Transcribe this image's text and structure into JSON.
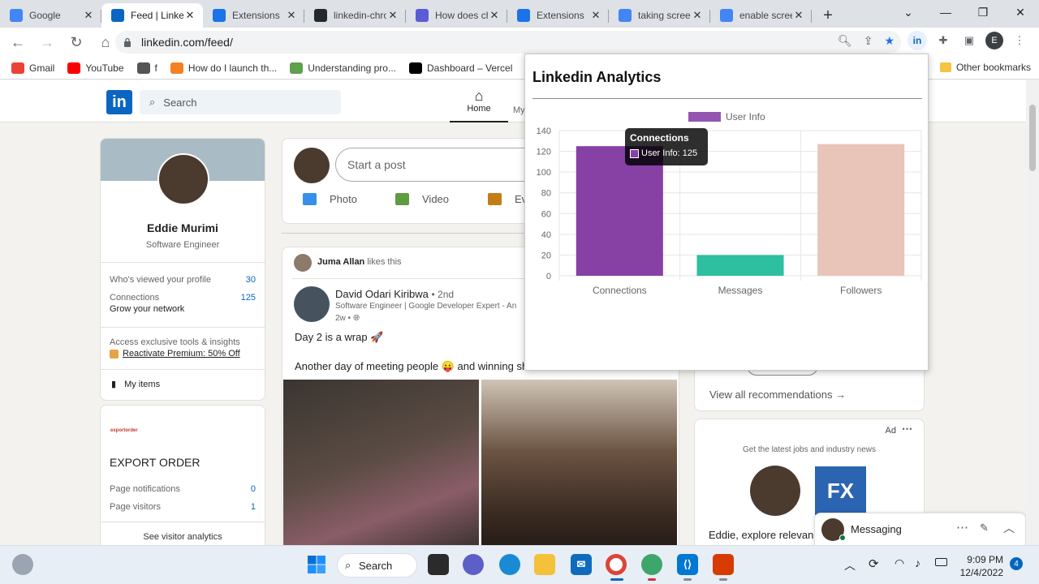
{
  "browser": {
    "tabs": [
      {
        "title": "Google",
        "icon": "google-icon",
        "color": "#4285f4"
      },
      {
        "title": "Feed | LinkedIn",
        "icon": "linkedin-icon",
        "color": "#0a66c2",
        "active": true
      },
      {
        "title": "Extensions",
        "icon": "puzzle-icon",
        "color": "#1a73e8"
      },
      {
        "title": "linkedin-chrome-ext",
        "icon": "github-icon",
        "color": "#24292f"
      },
      {
        "title": "How does chrome...",
        "icon": "page-icon",
        "color": "#5b5bd6"
      },
      {
        "title": "Extensions",
        "icon": "puzzle-icon",
        "color": "#1a73e8"
      },
      {
        "title": "taking screenshot",
        "icon": "google-icon",
        "color": "#4285f4"
      },
      {
        "title": "enable screenshot",
        "icon": "google-icon",
        "color": "#4285f4"
      }
    ],
    "url": "linkedin.com/feed/",
    "profile_initial": "E",
    "bookmarks": [
      {
        "label": "Gmail",
        "color": "#ea4335"
      },
      {
        "label": "YouTube",
        "color": "#ff0000"
      },
      {
        "label": "f",
        "color": "#555555"
      },
      {
        "label": "How do I launch th...",
        "color": "#f48024"
      },
      {
        "label": "Understanding pro...",
        "color": "#5fa04e"
      },
      {
        "label": "Dashboard – Vercel",
        "color": "#000000"
      }
    ],
    "other_bookmarks": "Other bookmarks"
  },
  "linkedin": {
    "search_placeholder": "Search",
    "nav_home": "Home",
    "nav_my": "My",
    "profile": {
      "name": "Eddie Murimi",
      "headline": "Software Engineer",
      "stats": [
        {
          "label": "Who's viewed your profile",
          "value": "30"
        },
        {
          "label": "Connections",
          "value": "125",
          "sub": "Grow your network"
        }
      ],
      "premium_text": "Access exclusive tools & insights",
      "premium_link": "Reactivate Premium: 50% Off",
      "my_items": "My items"
    },
    "page_card": {
      "logo_text": "exportorder",
      "title": "EXPORT ORDER",
      "rows": [
        {
          "label": "Page notifications",
          "value": "0"
        },
        {
          "label": "Page visitors",
          "value": "1"
        }
      ],
      "link": "See visitor analytics"
    },
    "composer": {
      "placeholder": "Start a post",
      "actions": [
        {
          "label": "Photo",
          "icon": "photo-icon",
          "color": "#378fe9"
        },
        {
          "label": "Video",
          "icon": "video-icon",
          "color": "#5f9b41"
        },
        {
          "label": "Eve",
          "icon": "event-icon",
          "color": "#c37d16"
        }
      ]
    },
    "post": {
      "liker": "Juma Allan",
      "liker_action": "likes this",
      "author": "David Odari Kiribwa",
      "degree": "• 2nd",
      "author_headline": "Software Engineer | Google Developer Expert - An",
      "time": "2w •",
      "line1": "Day 2 is a wrap 🚀",
      "line2": "Another day of meeting people 😛 and winning shi"
    },
    "right": {
      "view_all": "View all recommendations →",
      "ad_label": "Ad",
      "ad_tagline": "Get the latest jobs and industry news",
      "ad_text": "Eddie, explore relevan",
      "ad_logo_text": "FX",
      "messaging": "Messaging"
    }
  },
  "popup": {
    "title": "Linkedin Analytics",
    "tooltip_title": "Connections",
    "tooltip_body": "User Info: 125"
  },
  "chart_data": {
    "type": "bar",
    "categories": [
      "Connections",
      "Messages",
      "Followers"
    ],
    "series": [
      {
        "name": "User Info",
        "values": [
          125,
          20,
          127
        ]
      }
    ],
    "bar_colors": [
      "#8741a5",
      "#2dbf9f",
      "#e9c4b8"
    ],
    "legend_color": "#9356b0",
    "ylim": [
      0,
      140
    ],
    "yticks": [
      0,
      20,
      40,
      60,
      80,
      100,
      120,
      140
    ],
    "legend": "top"
  },
  "taskbar": {
    "search_label": "Search",
    "time": "9:09 PM",
    "date": "12/4/2022",
    "notifications": "4"
  }
}
